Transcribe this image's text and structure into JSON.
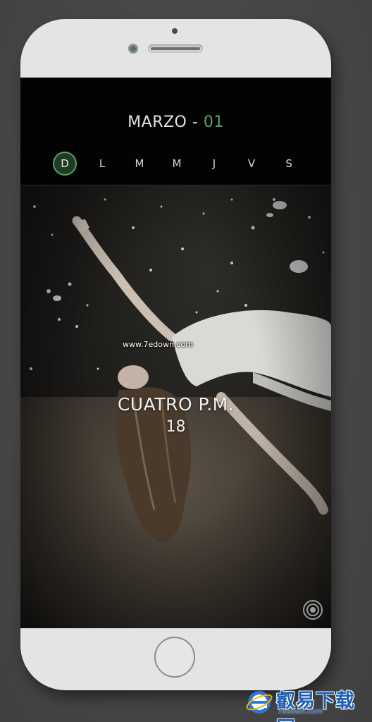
{
  "calendar": {
    "month": "MARZO",
    "separator": " - ",
    "day": "01",
    "weekdays": [
      {
        "label": "D",
        "active": true
      },
      {
        "label": "L",
        "active": false
      },
      {
        "label": "M",
        "active": false
      },
      {
        "label": "M",
        "active": false
      },
      {
        "label": "J",
        "active": false
      },
      {
        "label": "V",
        "active": false
      },
      {
        "label": "S",
        "active": false
      }
    ]
  },
  "clock": {
    "time_words": "CUATRO P.M.",
    "minutes": "18"
  },
  "watermark": {
    "text": "www.7edown.com"
  },
  "brand": {
    "name": "叡易下载网",
    "url": "7edown.com"
  },
  "icons": {
    "camera": "camera-shutter-icon",
    "logo": "ie-style-e-logo-icon"
  },
  "colors": {
    "accent_green": "#5fa36a",
    "header_bg": "#030303",
    "phone_body": "#e4e4e4"
  }
}
